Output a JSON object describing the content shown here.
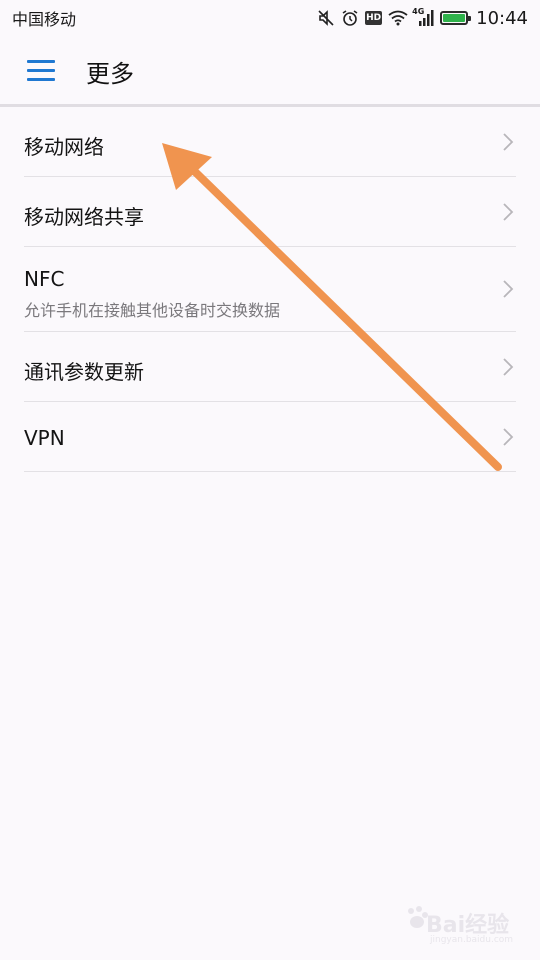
{
  "statusbar": {
    "carrier": "中国移动",
    "hd": "HD",
    "network": "4G",
    "time": "10:44"
  },
  "appbar": {
    "title": "更多",
    "menu_icon": "hamburger-menu-icon"
  },
  "items": [
    {
      "label": "移动网络",
      "sub": ""
    },
    {
      "label": "移动网络共享",
      "sub": ""
    },
    {
      "label": "NFC",
      "sub": "允许手机在接触其他设备时交换数据"
    },
    {
      "label": "通讯参数更新",
      "sub": ""
    },
    {
      "label": "VPN",
      "sub": ""
    }
  ],
  "watermark": {
    "text": "Bai经验",
    "sub": "jingyan.baidu.com"
  },
  "colors": {
    "accent": "#1f78d1",
    "annotation_arrow": "#f0944f",
    "battery": "#2fb24b"
  }
}
